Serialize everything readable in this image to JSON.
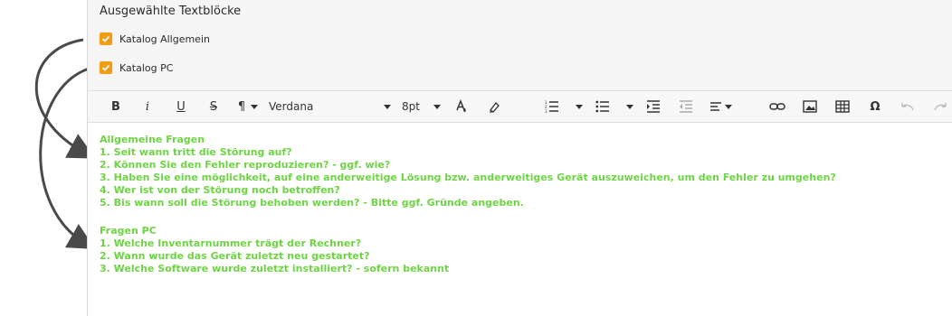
{
  "selected_blocks": {
    "title": "Ausgewählte Textblöcke",
    "items": [
      {
        "label": "Katalog Allgemein",
        "checked": true
      },
      {
        "label": "Katalog PC",
        "checked": true
      }
    ]
  },
  "toolbar": {
    "font_family": "Verdana",
    "font_size": "8pt",
    "bold_label": "B",
    "italic_label": "i",
    "underline_label": "U",
    "strike_label": "S",
    "paragraph_label": "¶",
    "special_char_label": "Ω"
  },
  "editor": {
    "text_color": "#6ed444",
    "block1": {
      "heading": "Allgemeine Fragen",
      "lines": [
        "1. Seit wann tritt die Störung auf?",
        "2. Können Sie den Fehler reproduzieren? - ggf. wie?",
        "3. Haben Sie eine möglichkeit, auf eine anderweitige Lösung bzw. anderweitiges Gerät auszuweichen, um den Fehler zu umgehen?",
        "4. Wer ist von der Störung noch betroffen?",
        "5. Bis wann soll die Störung behoben werden? - Bitte ggf. Gründe angeben."
      ]
    },
    "block2": {
      "heading": "Fragen PC",
      "lines": [
        "1. Welche Inventarnummer trägt der Rechner?",
        "2. Wann wurde das Gerät zuletzt neu gestartet?",
        "3. Welche Software wurde zuletzt installiert? - sofern bekannt"
      ]
    }
  },
  "colors": {
    "checkbox": "#f39c12",
    "arrow": "#4a4a4a"
  }
}
